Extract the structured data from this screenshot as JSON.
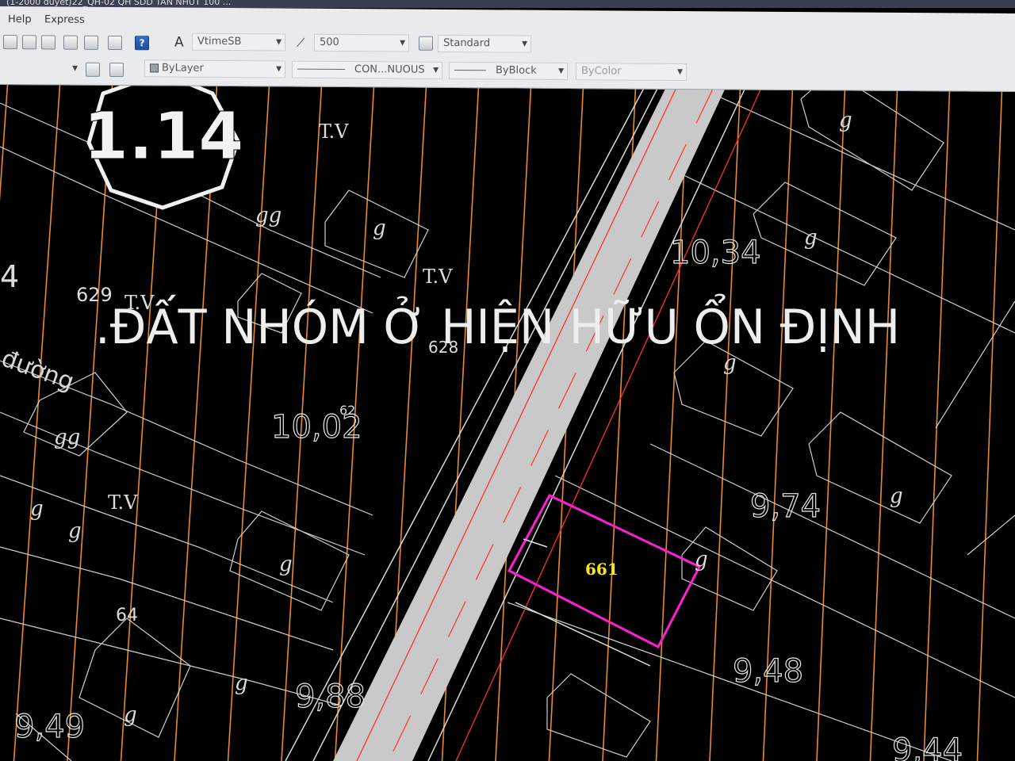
{
  "window": {
    "title": "(1-2000 duyet)22_QH-02 QH SDD TAN NHUT 100 ...",
    "menus": [
      "Help",
      "Express"
    ]
  },
  "toolbar": {
    "text_style": "VtimeSB",
    "dim_scale": "500",
    "table_style": "Standard",
    "layer": "ByLayer",
    "linetype": "CON...NUOUS",
    "lineweight": "ByBlock",
    "color": "ByColor"
  },
  "drawing": {
    "sheet_number": "1.14",
    "zone_label": ".ĐẤT NHÓM Ở HIỆN HỮU ỔN ĐỊNH",
    "road_text": "đường",
    "elevations": [
      "10,34",
      "10,02",
      "9,74",
      "9,48",
      "9,88",
      "9,49",
      "9,44"
    ],
    "parcel_numbers": [
      "629",
      "628",
      "62",
      "64",
      "661",
      "4"
    ],
    "tv_labels": [
      "T.V",
      "T.V",
      "T.V",
      "T.V"
    ],
    "house_marks": [
      "g",
      "gg",
      "g",
      "gg",
      "g",
      "g",
      "g",
      "g",
      "g",
      "g",
      "g",
      "g",
      "g"
    ],
    "highlighted_parcel": "661",
    "colors": {
      "grid_line": "#e8892c",
      "road_fill": "#c9c9c9",
      "highlight": "#ff1fd2",
      "parcel_label": "#ffe61a",
      "cad_line": "#d8d8d8",
      "red_line": "#ff3030"
    }
  }
}
